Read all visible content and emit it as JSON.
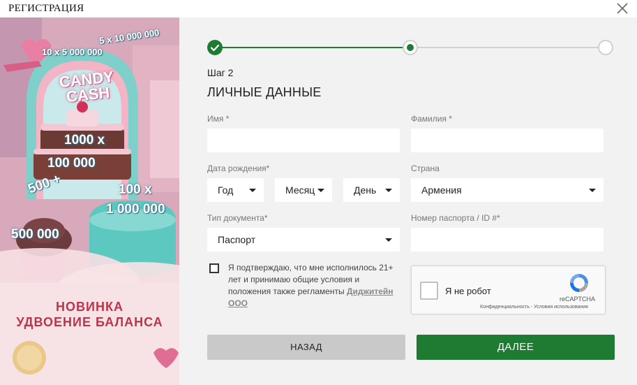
{
  "window": {
    "title": "РЕГИСТРАЦИЯ",
    "close_icon": "close-icon"
  },
  "promo": {
    "badges": [
      "5 x 10 000 000",
      "10 x 5 000 000",
      "1000 x",
      "100 000",
      "500 +",
      "100 x",
      "1 000 000",
      "500 000"
    ],
    "logo_line1": "CANDY",
    "logo_line2": "CASH",
    "headline_line1": "НОВИНКА",
    "headline_line2": "УДВОЕНИЕ БАЛАНСА"
  },
  "stepper": {
    "steps": [
      {
        "state": "complete",
        "icon": "check-icon"
      },
      {
        "state": "current"
      },
      {
        "state": "upcoming"
      }
    ],
    "colors": {
      "active": "#1f7a32",
      "inactive": "#d0d0d0"
    }
  },
  "form": {
    "step_label": "Шаг 2",
    "title": "ЛИЧНЫЕ ДАННЫЕ",
    "first_name": {
      "label": "Имя *",
      "value": ""
    },
    "last_name": {
      "label": "Фамилия *",
      "value": ""
    },
    "dob": {
      "label": "Дата рождения*",
      "year": "Год",
      "month": "Месяц",
      "day": "День"
    },
    "country": {
      "label": "Страна",
      "value": "Армения"
    },
    "doc_type": {
      "label": "Тип документа*",
      "value": "Паспорт"
    },
    "passport": {
      "label": "Номер паспорта / ID #*",
      "value": ""
    },
    "agree_text": "Я подтверждаю, что мне исполнилось 21+ лет и принимаю общие условия и положения также регламенты",
    "agree_link": "Диджитейн ООО",
    "recaptcha": {
      "label": "Я не робот",
      "brand": "reCAPTCHA",
      "links": "Конфиденциальность - Условия использования"
    },
    "back_label": "НАЗАД",
    "next_label": "ДАЛЕЕ"
  }
}
